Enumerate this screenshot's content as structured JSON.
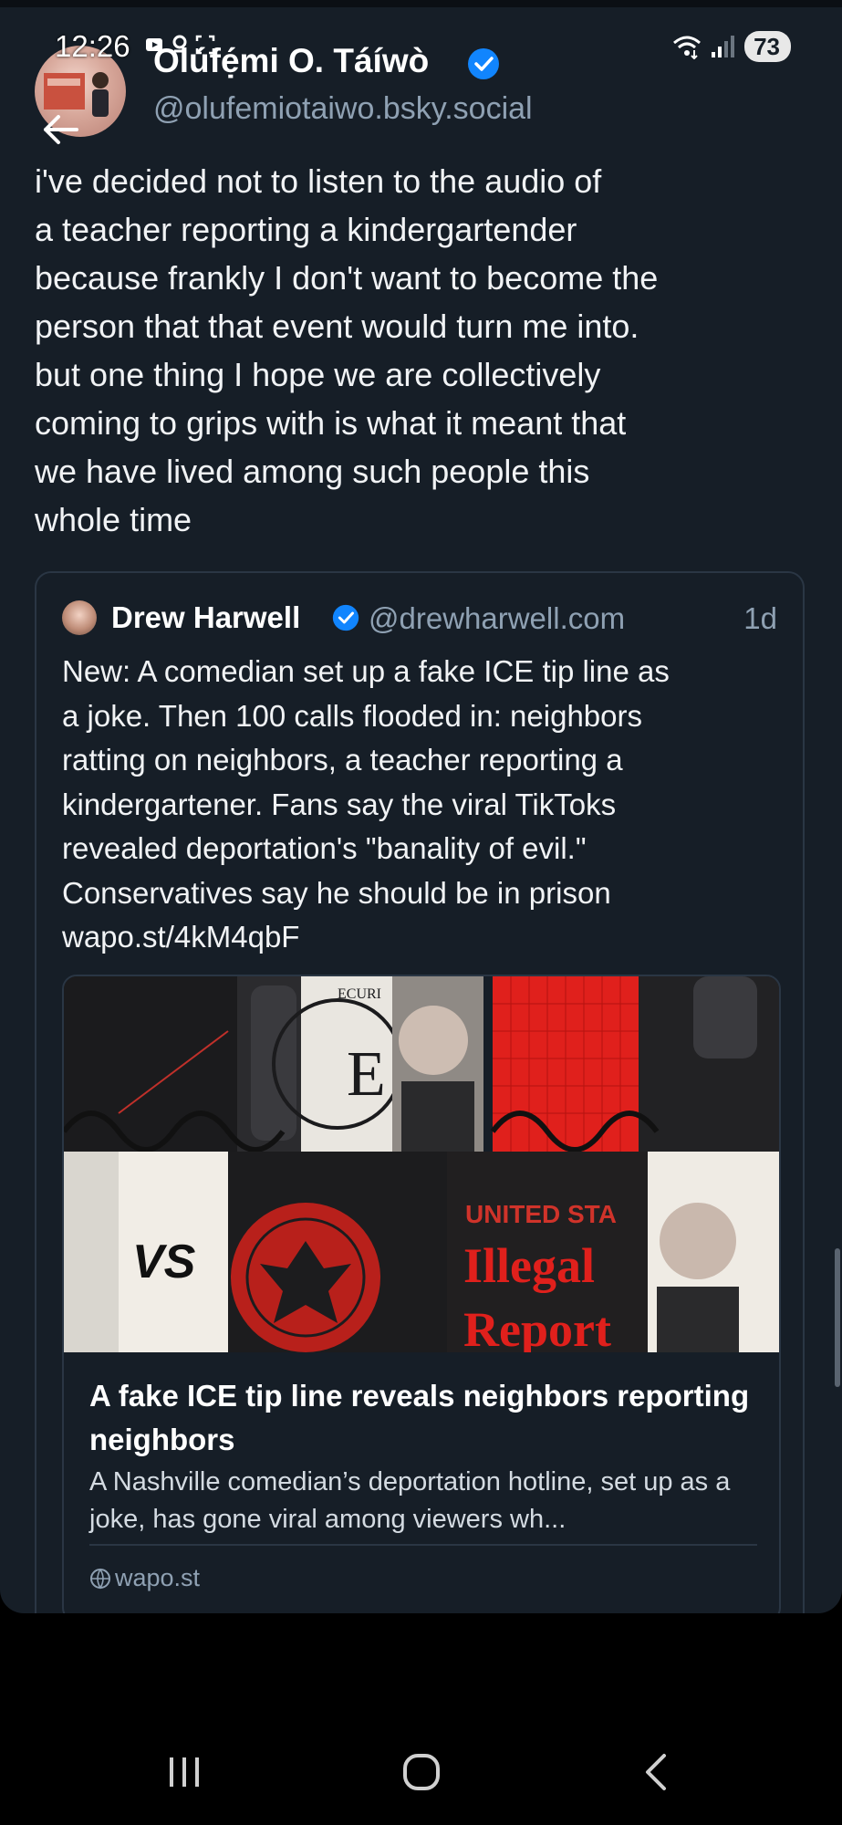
{
  "status_bar": {
    "time": "12:26",
    "battery": "73"
  },
  "post": {
    "author_name": "Olúfẹ́mi O. Táíwò",
    "author_handle": "@olufemiotaiwo.bsky.social",
    "text": "i've decided not to listen to the audio of\na teacher reporting a kindergartender\nbecause frankly I don't want to become the\nperson that that event would turn me into.\nbut one thing I hope we are collectively\ncoming to grips with is what it meant that\nwe have lived among such people this\nwhole time"
  },
  "quote": {
    "author_name": "Drew Harwell",
    "author_handle": "@drewharwell.com",
    "time": "1d",
    "text": "New: A comedian set up a fake ICE tip line as\na joke. Then 100 calls flooded in: neighbors\nratting on neighbors, a teacher reporting a\nkindergartener. Fans say the viral TikToks\nrevealed deportation's \"banality of evil.\"\nConservatives say he should be in prison\nwapo.st/4kM4qbF",
    "card": {
      "image_text_vs": "VS",
      "image_text_united": "UNITED STA",
      "image_text_illegal": "Illegal",
      "image_text_report": "Report",
      "image_text_seal": "E",
      "image_text_secur": "ECURI",
      "title": "A fake ICE tip line reveals neighbors reporting neighbors",
      "description": "A Nashville comedian’s deportation hotline, set up as a joke, has gone viral among viewers wh...",
      "domain": "wapo.st"
    }
  },
  "colors": {
    "background": "#161e27",
    "accent_verified": "#1185fe",
    "muted_text": "#8fa1b3",
    "red": "#e0201c"
  }
}
